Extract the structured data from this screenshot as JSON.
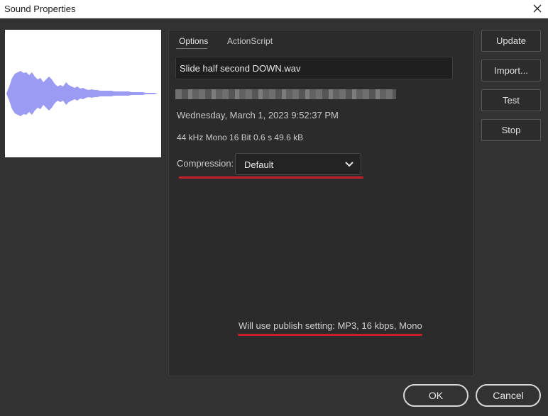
{
  "window": {
    "title": "Sound Properties"
  },
  "icons": {
    "close": "close-icon",
    "chevron": "chevron-down-icon"
  },
  "colors": {
    "background": "#323232",
    "panel": "#2b2b2b",
    "waveform": "#9b9bf4",
    "annotation_red": "#c8202a"
  },
  "tabs": [
    {
      "label": "Options",
      "active": true
    },
    {
      "label": "ActionScript",
      "active": false
    }
  ],
  "sound": {
    "filename": "Slide half second DOWN.wav",
    "date": "Wednesday, March 1, 2023  9:52:37 PM",
    "info": "44 kHz Mono 16 Bit 0.6 s 49.6 kB"
  },
  "compression": {
    "label": "Compression:",
    "selected": "Default"
  },
  "publish_note": "Will use publish setting: MP3, 16 kbps, Mono",
  "side_buttons": {
    "update": "Update",
    "import": "Import...",
    "test": "Test",
    "stop": "Stop"
  },
  "footer": {
    "ok": "OK",
    "cancel": "Cancel"
  }
}
